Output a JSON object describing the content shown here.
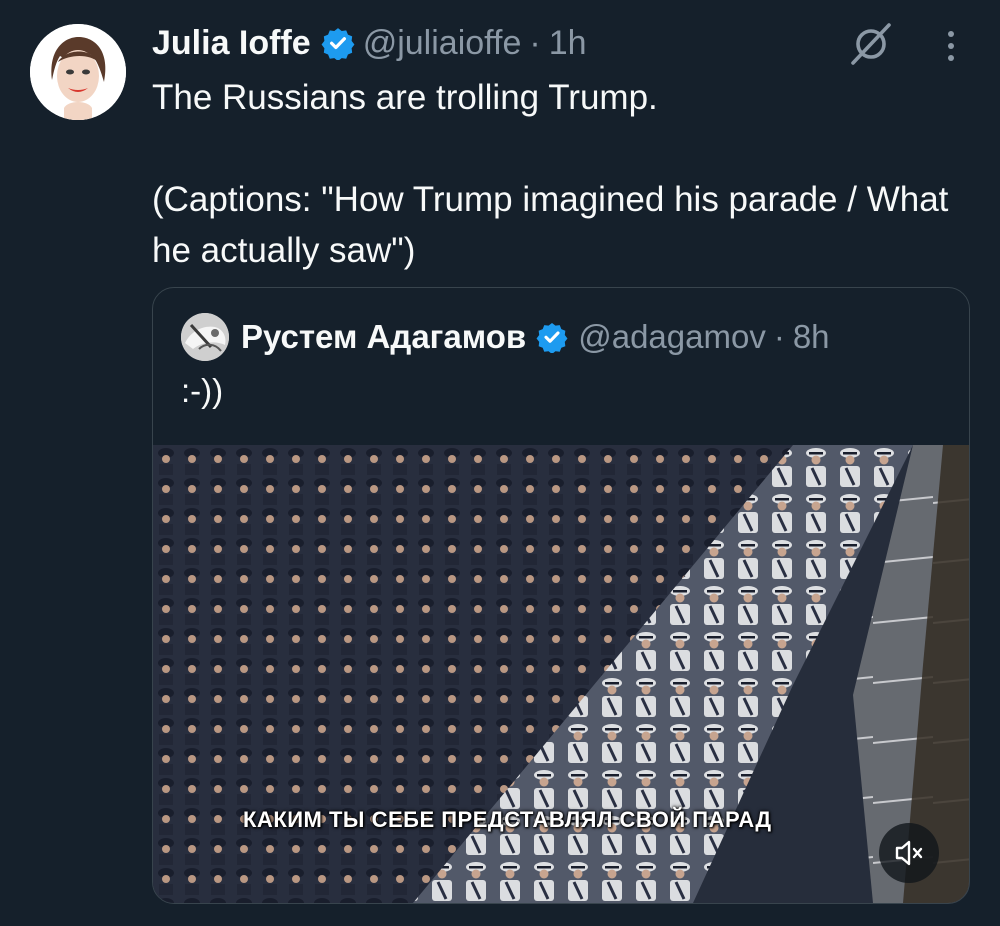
{
  "tweet": {
    "author_name": "Julia Ioffe",
    "handle": "@juliaioffe",
    "separator": "·",
    "time": "1h",
    "text_line1": "The Russians are trolling Trump.",
    "text_line2": "(Captions: \"How Trump imagined his parade / What he actually saw\")"
  },
  "quote": {
    "author_name": "Рустем Адагамов",
    "handle": "@adagamov",
    "separator": "·",
    "time": "8h",
    "text": ":-))",
    "video_caption": "КАКИМ ТЫ СЕБЕ ПРЕДСТАВЛЯЛ СВОЙ ПАРАД"
  },
  "icons": {
    "verified": "verified-badge-icon",
    "grok": "grok-icon",
    "more": "more-icon",
    "mute": "volume-muted-icon"
  },
  "colors": {
    "background": "#15202b",
    "text_primary": "#f7f9f9",
    "text_secondary": "#8b98a5",
    "verified_blue": "#1d9bf0",
    "quote_border": "#38444d"
  }
}
